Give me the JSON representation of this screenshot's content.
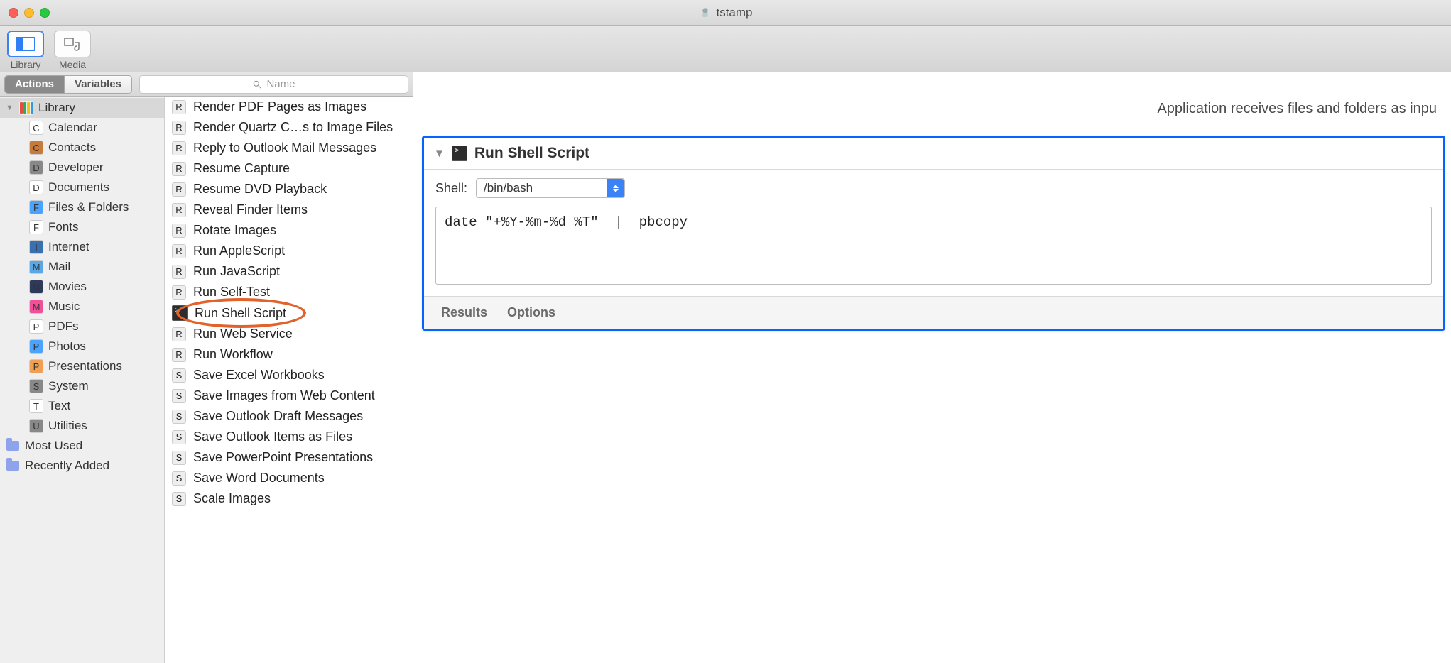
{
  "window": {
    "title": "tstamp"
  },
  "toolbar": {
    "library_label": "Library",
    "media_label": "Media"
  },
  "segmented": {
    "actions": "Actions",
    "variables": "Variables"
  },
  "search": {
    "placeholder": "Name"
  },
  "sidebar": {
    "library": "Library",
    "items": [
      "Calendar",
      "Contacts",
      "Developer",
      "Documents",
      "Files & Folders",
      "Fonts",
      "Internet",
      "Mail",
      "Movies",
      "Music",
      "PDFs",
      "Photos",
      "Presentations",
      "System",
      "Text",
      "Utilities"
    ],
    "most_used": "Most Used",
    "recently_added": "Recently Added"
  },
  "actions": [
    "Render PDF Pages as Images",
    "Render Quartz C…s to Image Files",
    "Reply to Outlook Mail Messages",
    "Resume Capture",
    "Resume DVD Playback",
    "Reveal Finder Items",
    "Rotate Images",
    "Run AppleScript",
    "Run JavaScript",
    "Run Self-Test",
    "Run Shell Script",
    "Run Web Service",
    "Run Workflow",
    "Save Excel Workbooks",
    "Save Images from Web Content",
    "Save Outlook Draft Messages",
    "Save Outlook Items as Files",
    "Save PowerPoint Presentations",
    "Save Word Documents",
    "Scale Images"
  ],
  "highlighted_action_index": 10,
  "workflow": {
    "input_banner": "Application receives files and folders as inpu",
    "card": {
      "title": "Run Shell Script",
      "shell_label": "Shell:",
      "shell_value": "/bin/bash",
      "code": "date \"+%Y-%m-%d %T\"  |  pbcopy",
      "results": "Results",
      "options": "Options"
    }
  }
}
